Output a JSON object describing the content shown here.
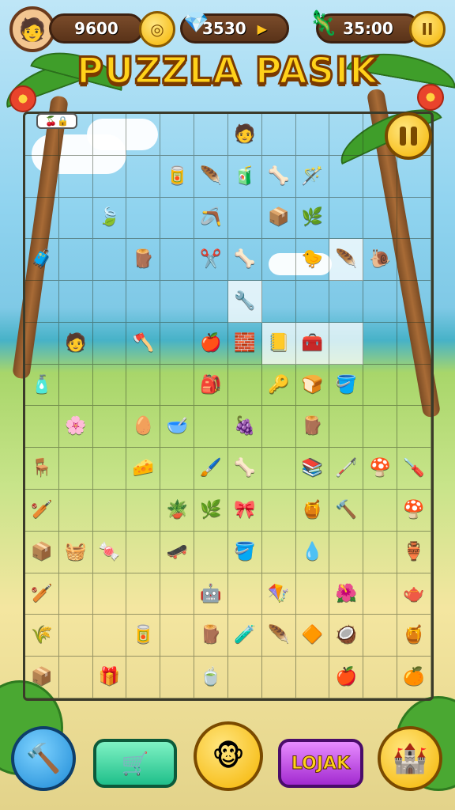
{
  "hud": {
    "score": "9600",
    "gems": "3530",
    "timer": "35:00",
    "pause_symbol": "II"
  },
  "title": "PUZZLA PASIK",
  "bottom": {
    "lojak_label": "LOJAK"
  },
  "board": {
    "cols": 12,
    "rows": 14,
    "highlight_cells": [
      [
        6,
        4
      ],
      [
        9,
        3
      ],
      [
        7,
        5
      ],
      [
        8,
        5
      ],
      [
        9,
        5
      ]
    ],
    "items": [
      {
        "r": 0,
        "c": 6,
        "icon": "🧑",
        "name": "pirate-head-icon"
      },
      {
        "r": 1,
        "c": 4,
        "icon": "🥫",
        "name": "jar-icon"
      },
      {
        "r": 1,
        "c": 5,
        "icon": "🪶",
        "name": "feather-icon"
      },
      {
        "r": 1,
        "c": 6,
        "icon": "🧃",
        "name": "paint-can-icon"
      },
      {
        "r": 1,
        "c": 7,
        "icon": "🦴",
        "name": "stick-icon"
      },
      {
        "r": 1,
        "c": 8,
        "icon": "🪄",
        "name": "broom-icon"
      },
      {
        "r": 2,
        "c": 2,
        "icon": "🍃",
        "name": "leaf-icon"
      },
      {
        "r": 2,
        "c": 5,
        "icon": "🪃",
        "name": "slingshot-icon"
      },
      {
        "r": 2,
        "c": 7,
        "icon": "📦",
        "name": "box-icon"
      },
      {
        "r": 2,
        "c": 8,
        "icon": "🌿",
        "name": "leaf-icon"
      },
      {
        "r": 3,
        "c": 0,
        "icon": "🧳",
        "name": "crate-icon"
      },
      {
        "r": 3,
        "c": 3,
        "icon": "🪵",
        "name": "plank-icon"
      },
      {
        "r": 3,
        "c": 5,
        "icon": "✂️",
        "name": "scissors-icon"
      },
      {
        "r": 3,
        "c": 6,
        "icon": "🦴",
        "name": "stick-icon"
      },
      {
        "r": 3,
        "c": 8,
        "icon": "🐤",
        "name": "bird-icon"
      },
      {
        "r": 3,
        "c": 9,
        "icon": "🪶",
        "name": "feather-icon"
      },
      {
        "r": 3,
        "c": 10,
        "icon": "🐌",
        "name": "snail-icon"
      },
      {
        "r": 4,
        "c": 6,
        "icon": "🔧",
        "name": "wrench-icon"
      },
      {
        "r": 5,
        "c": 1,
        "icon": "🧑",
        "name": "pirate-head-icon"
      },
      {
        "r": 5,
        "c": 3,
        "icon": "🪓",
        "name": "hammer-icon"
      },
      {
        "r": 5,
        "c": 5,
        "icon": "🍎",
        "name": "apple-icon"
      },
      {
        "r": 5,
        "c": 6,
        "icon": "🧱",
        "name": "block-icon"
      },
      {
        "r": 5,
        "c": 7,
        "icon": "📒",
        "name": "book-icon"
      },
      {
        "r": 5,
        "c": 8,
        "icon": "🧰",
        "name": "toolbox-icon"
      },
      {
        "r": 6,
        "c": 0,
        "icon": "🧴",
        "name": "bottle-icon"
      },
      {
        "r": 6,
        "c": 5,
        "icon": "🎒",
        "name": "bag-icon"
      },
      {
        "r": 6,
        "c": 7,
        "icon": "🔑",
        "name": "key-icon"
      },
      {
        "r": 6,
        "c": 8,
        "icon": "🍞",
        "name": "bread-icon"
      },
      {
        "r": 6,
        "c": 9,
        "icon": "🪣",
        "name": "bucket-icon"
      },
      {
        "r": 7,
        "c": 1,
        "icon": "🌸",
        "name": "vine-icon"
      },
      {
        "r": 7,
        "c": 3,
        "icon": "🥚",
        "name": "egg-icon"
      },
      {
        "r": 7,
        "c": 4,
        "icon": "🥣",
        "name": "bowl-icon"
      },
      {
        "r": 7,
        "c": 6,
        "icon": "🍇",
        "name": "plum-icon"
      },
      {
        "r": 7,
        "c": 8,
        "icon": "🪵",
        "name": "log-icon"
      },
      {
        "r": 8,
        "c": 0,
        "icon": "🪑",
        "name": "stool-icon"
      },
      {
        "r": 8,
        "c": 3,
        "icon": "🧀",
        "name": "cheese-icon"
      },
      {
        "r": 8,
        "c": 5,
        "icon": "🖌️",
        "name": "brush-icon"
      },
      {
        "r": 8,
        "c": 6,
        "icon": "🦴",
        "name": "stick-icon"
      },
      {
        "r": 8,
        "c": 8,
        "icon": "📚",
        "name": "books-icon"
      },
      {
        "r": 8,
        "c": 9,
        "icon": "🦯",
        "name": "cane-icon"
      },
      {
        "r": 8,
        "c": 10,
        "icon": "🍄",
        "name": "mushroom-icon"
      },
      {
        "r": 8,
        "c": 11,
        "icon": "🪛",
        "name": "screwdriver-icon"
      },
      {
        "r": 9,
        "c": 0,
        "icon": "🏏",
        "name": "bat-icon"
      },
      {
        "r": 9,
        "c": 4,
        "icon": "🪴",
        "name": "pot-icon"
      },
      {
        "r": 9,
        "c": 5,
        "icon": "🌿",
        "name": "plant-icon"
      },
      {
        "r": 9,
        "c": 6,
        "icon": "🎀",
        "name": "bow-icon"
      },
      {
        "r": 9,
        "c": 8,
        "icon": "🍯",
        "name": "honey-jar-icon"
      },
      {
        "r": 9,
        "c": 9,
        "icon": "🔨",
        "name": "pickaxe-icon"
      },
      {
        "r": 9,
        "c": 11,
        "icon": "🍄",
        "name": "mushroom-icon"
      },
      {
        "r": 10,
        "c": 0,
        "icon": "📦",
        "name": "crate-icon"
      },
      {
        "r": 10,
        "c": 1,
        "icon": "🧺",
        "name": "basket-icon"
      },
      {
        "r": 10,
        "c": 2,
        "icon": "🍬",
        "name": "candy-icon"
      },
      {
        "r": 10,
        "c": 4,
        "icon": "🛹",
        "name": "board-icon"
      },
      {
        "r": 10,
        "c": 6,
        "icon": "🪣",
        "name": "bucket-icon"
      },
      {
        "r": 10,
        "c": 8,
        "icon": "💧",
        "name": "drop-icon"
      },
      {
        "r": 10,
        "c": 11,
        "icon": "🏺",
        "name": "vase-icon"
      },
      {
        "r": 11,
        "c": 0,
        "icon": "🏏",
        "name": "bat-icon"
      },
      {
        "r": 11,
        "c": 5,
        "icon": "🤖",
        "name": "robot-icon"
      },
      {
        "r": 11,
        "c": 7,
        "icon": "🪁",
        "name": "kite-icon"
      },
      {
        "r": 11,
        "c": 9,
        "icon": "🌺",
        "name": "flower-icon"
      },
      {
        "r": 11,
        "c": 11,
        "icon": "🫖",
        "name": "watering-can-icon"
      },
      {
        "r": 12,
        "c": 0,
        "icon": "🌾",
        "name": "grain-icon"
      },
      {
        "r": 12,
        "c": 3,
        "icon": "🥫",
        "name": "can-icon"
      },
      {
        "r": 12,
        "c": 5,
        "icon": "🪵",
        "name": "log-icon"
      },
      {
        "r": 12,
        "c": 6,
        "icon": "🧪",
        "name": "tube-icon"
      },
      {
        "r": 12,
        "c": 7,
        "icon": "🪶",
        "name": "feather-icon"
      },
      {
        "r": 12,
        "c": 8,
        "icon": "🔶",
        "name": "gem-icon"
      },
      {
        "r": 12,
        "c": 9,
        "icon": "🥥",
        "name": "coconut-icon"
      },
      {
        "r": 12,
        "c": 11,
        "icon": "🍯",
        "name": "honey-jar-icon"
      },
      {
        "r": 13,
        "c": 0,
        "icon": "📦",
        "name": "crate-icon"
      },
      {
        "r": 13,
        "c": 2,
        "icon": "🎁",
        "name": "gift-icon"
      },
      {
        "r": 13,
        "c": 5,
        "icon": "🍵",
        "name": "cup-icon"
      },
      {
        "r": 13,
        "c": 9,
        "icon": "🍎",
        "name": "apple-icon"
      },
      {
        "r": 13,
        "c": 11,
        "icon": "🍊",
        "name": "orange-icon"
      }
    ]
  }
}
